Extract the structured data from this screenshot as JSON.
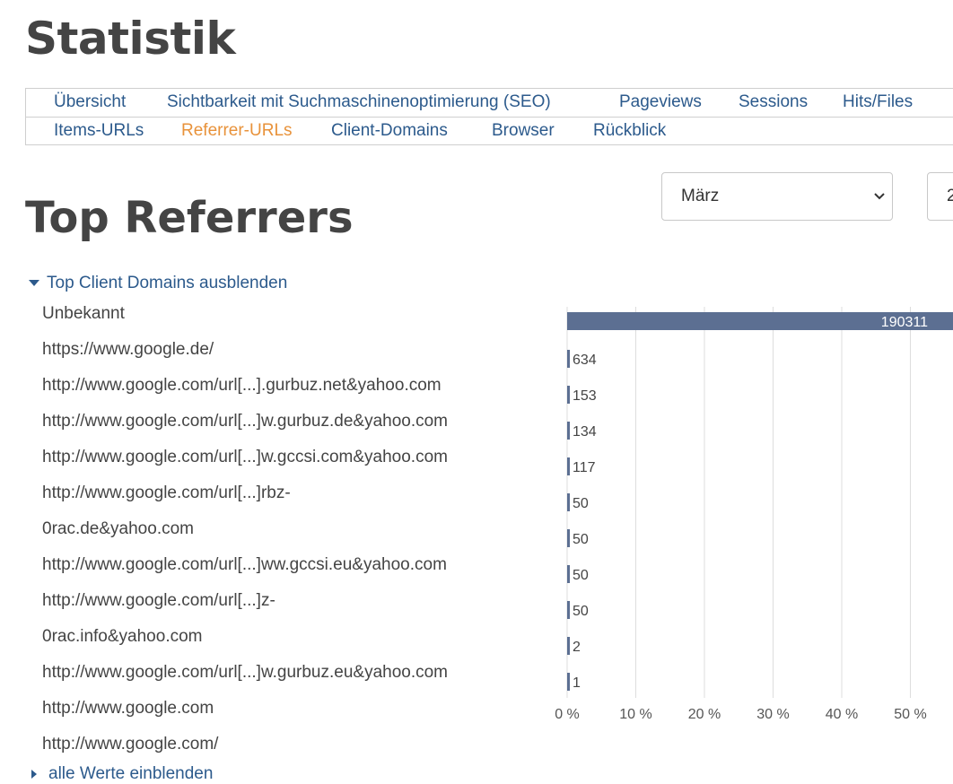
{
  "page": {
    "title": "Statistik",
    "section_title": "Top Referrers"
  },
  "tabs": {
    "row1": [
      "Übersicht",
      "Sichtbarkeit mit Suchmaschinenoptimierung (SEO)",
      "Pageviews",
      "Sessions",
      "Hits/Files",
      ""
    ],
    "row2": [
      "Items-URLs",
      "Referrer-URLs",
      "Client-Domains",
      "Browser",
      "Rückblick"
    ],
    "active": "Referrer-URLs"
  },
  "filters": {
    "month": "März",
    "year_partial": "2"
  },
  "toggles": {
    "hide_top_domains": "Top Client Domains ausblenden",
    "show_all": "alle Werte einblenden"
  },
  "referrer_rows": [
    "Unbekannt",
    "https://www.google.de/",
    "http://www.google.com/url[...].gurbuz.net&yahoo.com",
    "http://www.google.com/url[...]w.gurbuz.de&yahoo.com",
    "http://www.google.com/url[...]w.gccsi.com&yahoo.com",
    "http://www.google.com/url[...]rbz-",
    "0rac.de&yahoo.com",
    "http://www.google.com/url[...]ww.gccsi.eu&yahoo.com",
    "http://www.google.com/url[...]z-",
    "0rac.info&yahoo.com",
    "http://www.google.com/url[...]w.gurbuz.eu&yahoo.com",
    "http://www.google.com",
    "http://www.google.com/"
  ],
  "colors": {
    "bar": "#5c6f92",
    "grid": "#dddddd",
    "link": "#2c5a8c",
    "active_tab": "#e8923a"
  },
  "chart_data": {
    "type": "bar",
    "orientation": "horizontal",
    "values": [
      190311,
      634,
      153,
      134,
      117,
      50,
      50,
      50,
      50,
      2,
      1
    ],
    "data_labels": [
      "190311",
      "634",
      "153",
      "134",
      "117",
      "50",
      "50",
      "50",
      "50",
      "2",
      "1"
    ],
    "x_ticks": [
      "0 %",
      "10 %",
      "20 %",
      "30 %",
      "40 %",
      "50 %"
    ],
    "xlim_percent": [
      0,
      56
    ],
    "grid": true
  }
}
